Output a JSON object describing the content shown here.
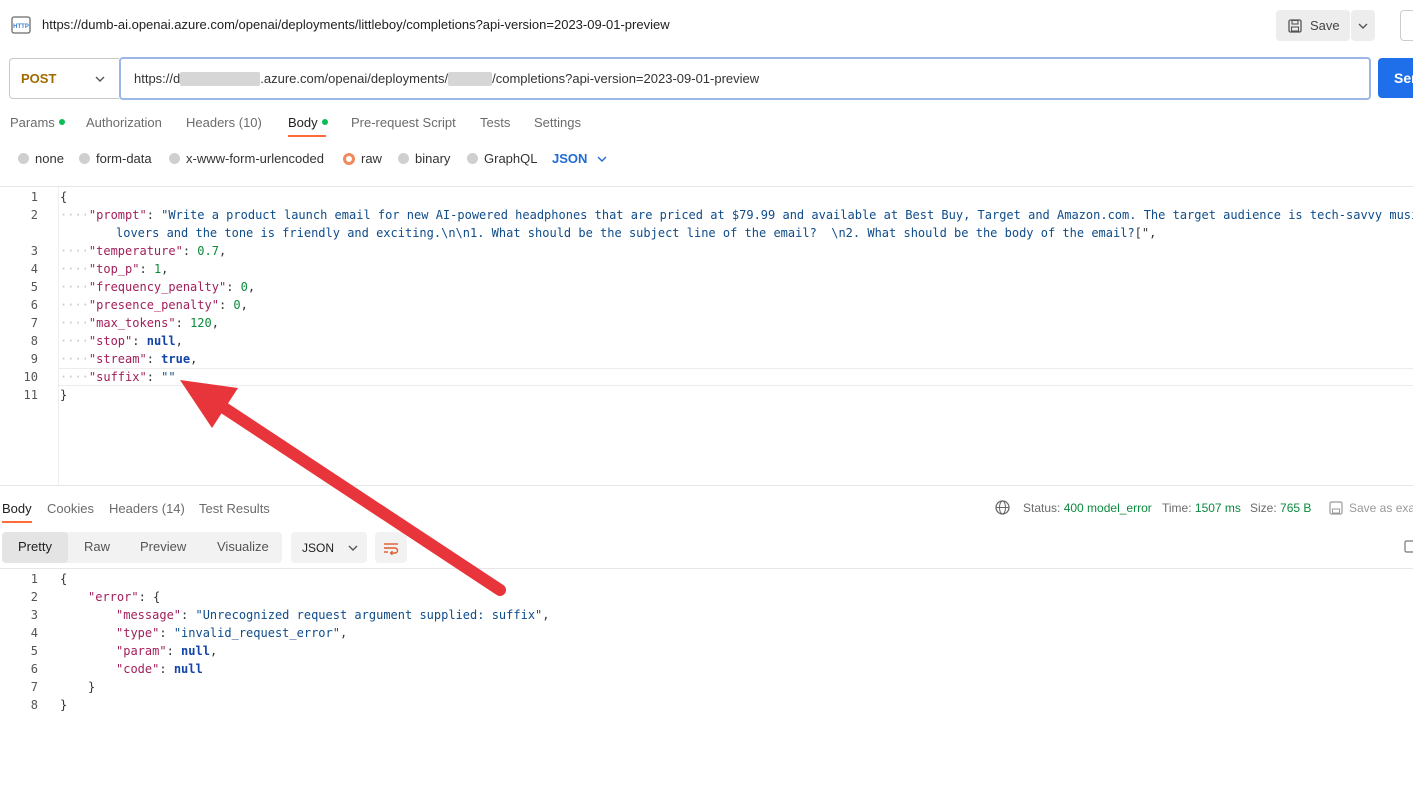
{
  "title_bar": {
    "url": "https://dumb-ai.openai.azure.com/openai/deployments/littleboy/completions?api-version=2023-09-01-preview",
    "save_label": "Save"
  },
  "request": {
    "method": "POST",
    "url_part1": "https://d",
    "url_part2": ".azure.com/openai/deployments/",
    "url_part3": "/completions?api-version=2023-09-01-preview",
    "send_label": "Send"
  },
  "tabs": {
    "params": "Params",
    "authorization": "Authorization",
    "headers": "Headers (10)",
    "body": "Body",
    "prerequest": "Pre-request Script",
    "tests": "Tests",
    "settings": "Settings"
  },
  "body_types": {
    "none": "none",
    "form_data": "form-data",
    "urlencoded": "x-www-form-urlencoded",
    "raw": "raw",
    "binary": "binary",
    "graphql": "GraphQL",
    "format": "JSON"
  },
  "request_body": {
    "line_numbers": [
      "1",
      "2",
      "3",
      "4",
      "5",
      "6",
      "7",
      "8",
      "9",
      "10",
      "11"
    ],
    "prompt_key": "\"prompt\"",
    "prompt_val_1": "\"Write a product launch email for new AI-powered headphones that are priced at $79.99 and available at Best Buy, Target and Amazon.com. The target audience is tech-savvy music",
    "prompt_val_2": "lovers and the tone is friendly and exciting.\\n\\n1. What should be the subject line of the email?  \\n2. What should be the body of the email?",
    "temperature_key": "\"temperature\"",
    "temperature_val": "0.7",
    "top_p_key": "\"top_p\"",
    "top_p_val": "1",
    "frequency_key": "\"frequency_penalty\"",
    "frequency_val": "0",
    "presence_key": "\"presence_penalty\"",
    "presence_val": "0",
    "max_tokens_key": "\"max_tokens\"",
    "max_tokens_val": "120",
    "stop_key": "\"stop\"",
    "stop_val": "null",
    "stream_key": "\"stream\"",
    "stream_val": "true",
    "suffix_key": "\"suffix\"",
    "suffix_val": "\"\""
  },
  "response": {
    "tabs": {
      "body": "Body",
      "cookies": "Cookies",
      "headers": "Headers (14)",
      "test_results": "Test Results"
    },
    "status_label": "Status:",
    "status_value": "400 model_error",
    "time_label": "Time:",
    "time_value": "1507 ms",
    "size_label": "Size:",
    "size_value": "765 B",
    "save_as": "Save as example",
    "views": {
      "pretty": "Pretty",
      "raw": "Raw",
      "preview": "Preview",
      "visualize": "Visualize"
    },
    "format": "JSON",
    "body": {
      "line_numbers": [
        "1",
        "2",
        "3",
        "4",
        "5",
        "6",
        "7",
        "8"
      ],
      "error_key": "\"error\"",
      "message_key": "\"message\"",
      "message_val": "\"Unrecognized request argument supplied: suffix\"",
      "type_key": "\"type\"",
      "type_val": "\"invalid_request_error\"",
      "param_key": "\"param\"",
      "param_val": "null",
      "code_key": "\"code\"",
      "code_val": "null"
    }
  },
  "colors": {
    "accent_orange": "#ff6c37",
    "send_blue": "#1f6feb",
    "annotation_red": "#e8353b",
    "method_post": "#a06a00",
    "status_green": "#0b8a3e"
  }
}
